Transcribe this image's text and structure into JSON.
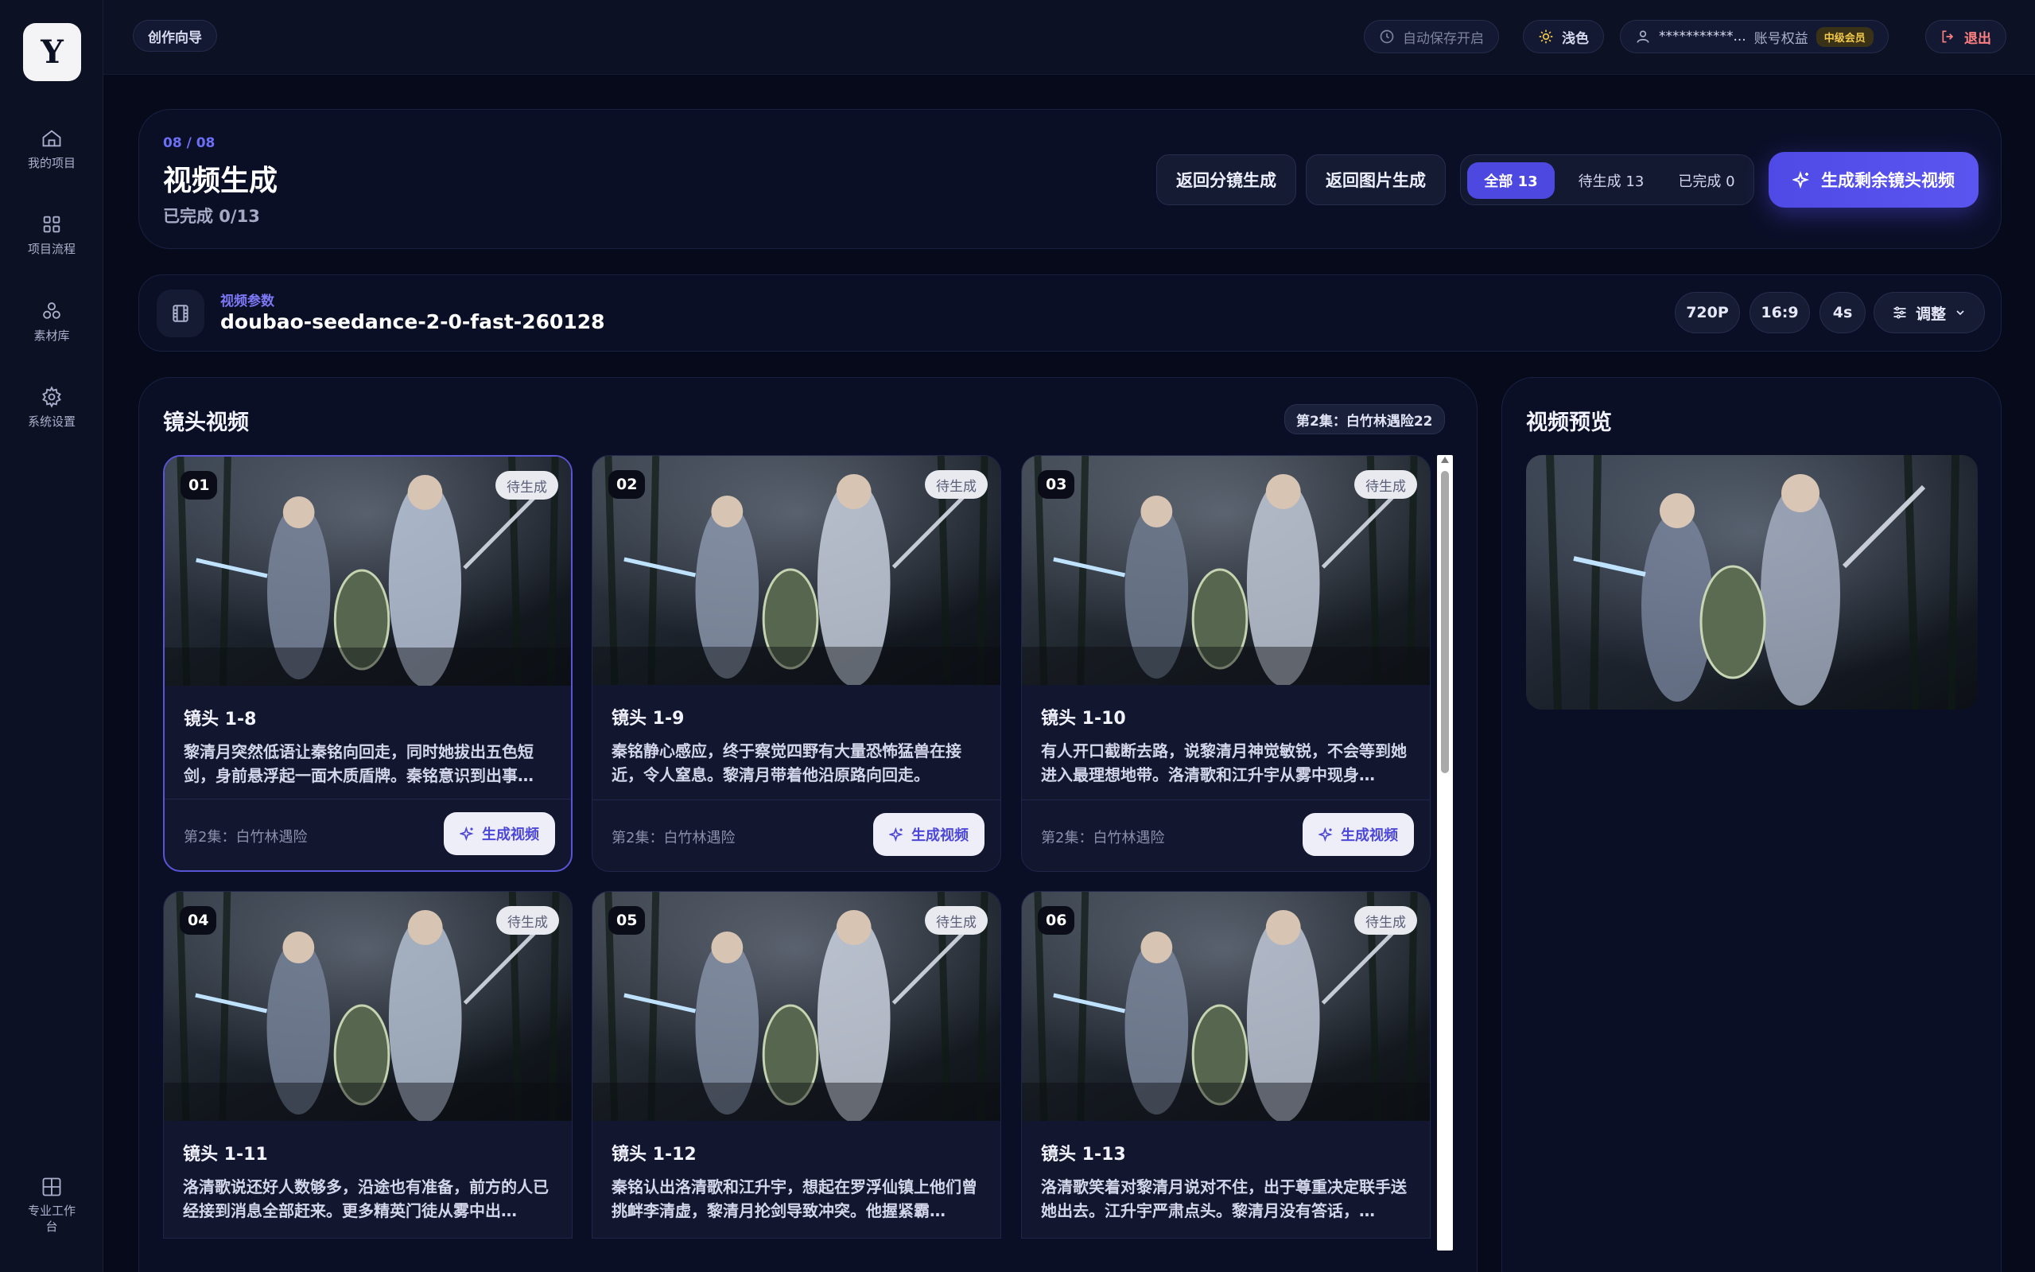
{
  "app": {
    "logo_text": "Y"
  },
  "sidebar": {
    "items": [
      {
        "label": "我的项目",
        "icon": "home-icon"
      },
      {
        "label": "项目流程",
        "icon": "grid-icon"
      },
      {
        "label": "素材库",
        "icon": "cluster-icon"
      },
      {
        "label": "系统设置",
        "icon": "gear-icon"
      }
    ],
    "bottom": {
      "label": "专业工作台",
      "icon": "workbench-icon"
    }
  },
  "topbar": {
    "wizard_label": "创作向导",
    "autosave_label": "自动保存开启",
    "theme_label": "浅色",
    "account_name": "***********...",
    "account_rights": "账号权益",
    "member_badge": "中级会员",
    "logout_label": "退出"
  },
  "header": {
    "step": "08 / 08",
    "title": "视频生成",
    "progress": "已完成 0/13",
    "back_storyboard": "返回分镜生成",
    "back_image": "返回图片生成",
    "filters": [
      {
        "label": "全部 13",
        "active": true
      },
      {
        "label": "待生成 13",
        "active": false
      },
      {
        "label": "已完成 0",
        "active": false
      }
    ],
    "generate_all": "生成剩余镜头视频"
  },
  "params": {
    "label": "视频参数",
    "model": "doubao-seedance-2-0-fast-260128",
    "resolution": "720P",
    "ratio": "16:9",
    "duration": "4s",
    "adjust": "调整"
  },
  "shots": {
    "title": "镜头视频",
    "episode_tag": "第2集：白竹林遇险22",
    "cards": [
      {
        "num": "01",
        "status": "待生成",
        "title": "镜头 1-8",
        "desc": "黎清月突然低语让秦铭向回走，同时她拔出五色短剑，身前悬浮起一面木质盾牌。秦铭意识到出事…",
        "episode": "第2集：白竹林遇险",
        "button": "生成视频"
      },
      {
        "num": "02",
        "status": "待生成",
        "title": "镜头 1-9",
        "desc": "秦铭静心感应，终于察觉四野有大量恐怖猛兽在接近，令人窒息。黎清月带着他沿原路向回走。",
        "episode": "第2集：白竹林遇险",
        "button": "生成视频"
      },
      {
        "num": "03",
        "status": "待生成",
        "title": "镜头 1-10",
        "desc": "有人开口截断去路，说黎清月神觉敏锐，不会等到她进入最理想地带。洛清歌和江升宇从雾中现身…",
        "episode": "第2集：白竹林遇险",
        "button": "生成视频"
      },
      {
        "num": "04",
        "status": "待生成",
        "title": "镜头 1-11",
        "desc": "洛清歌说还好人数够多，沿途也有准备，前方的人已经接到消息全部赶来。更多精英门徒从雾中出…",
        "episode": "",
        "button": ""
      },
      {
        "num": "05",
        "status": "待生成",
        "title": "镜头 1-12",
        "desc": "秦铭认出洛清歌和江升宇，想起在罗浮仙镇上他们曾挑衅李清虚，黎清月抡剑导致冲突。他握紧霸…",
        "episode": "",
        "button": ""
      },
      {
        "num": "06",
        "status": "待生成",
        "title": "镜头 1-13",
        "desc": "洛清歌笑着对黎清月说对不住，出于尊重决定联手送她出去。江升宇严肃点头。黎清月没有答话，…",
        "episode": "",
        "button": ""
      }
    ]
  },
  "preview": {
    "title": "视频预览"
  }
}
